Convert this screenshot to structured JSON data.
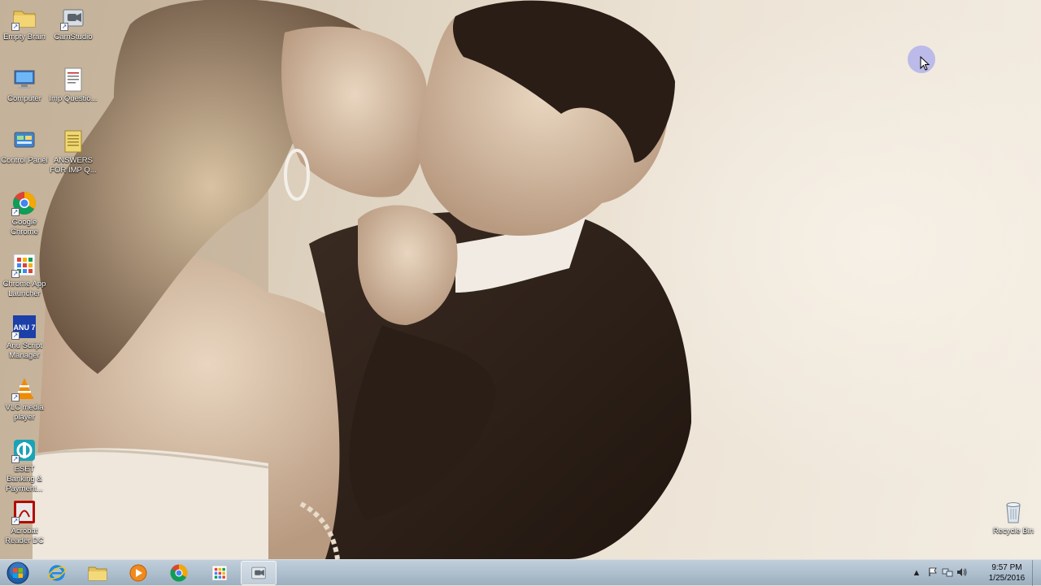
{
  "desktop_icons": [
    {
      "label": "Empty Brain",
      "icon": "folder-icon"
    },
    {
      "label": "CamStudio",
      "icon": "camstudio-icon"
    },
    {
      "label": "Computer",
      "icon": "computer-icon"
    },
    {
      "label": "Imp Questio...",
      "icon": "document-icon"
    },
    {
      "label": "Control Panel",
      "icon": "control-panel-icon"
    },
    {
      "label": "ANSWERS FOR IMP Q...",
      "icon": "notepad-icon"
    },
    {
      "label": "Google Chrome",
      "icon": "chrome-icon"
    },
    {
      "label": "Chrome App Launcher",
      "icon": "app-launcher-icon"
    },
    {
      "label": "Anu Script Manager",
      "icon": "anu-script-icon",
      "badge": "ANU 7"
    },
    {
      "label": "VLC media player",
      "icon": "vlc-icon"
    },
    {
      "label": "ESET Banking & Payment...",
      "icon": "eset-icon"
    },
    {
      "label": "Acrobat Reader DC",
      "icon": "acrobat-icon"
    },
    {
      "label": "Recycle Bin",
      "icon": "recycle-bin-icon"
    }
  ],
  "taskbar": {
    "pinned": [
      "internet-explorer-icon",
      "explorer-folder-icon",
      "media-player-icon",
      "chrome-icon",
      "app-launcher-icon",
      "camstudio-icon"
    ],
    "active": "camstudio-icon"
  },
  "tray": {
    "overflow_glyph": "▲",
    "time": "9:57 PM",
    "date": "1/25/2016"
  },
  "colors": {
    "taskbar": "#a9bccd",
    "wallpaper_light": "#f3ece1",
    "wallpaper_dark": "#2e211a"
  }
}
